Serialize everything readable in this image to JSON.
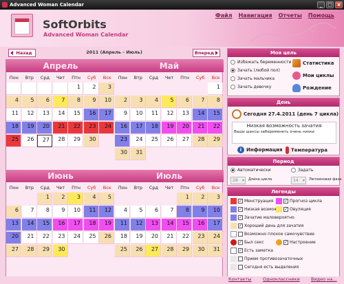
{
  "window": {
    "title": "Advanced Woman Calendar",
    "min": "_",
    "max": "□",
    "close": "x"
  },
  "header": {
    "brand": "SoftOrbits",
    "product": "Advanced Woman Calendar"
  },
  "menu": [
    "Файл",
    "Навигация",
    "Отчеты",
    "Помощь"
  ],
  "nav": {
    "prev": "Назад",
    "next": "Вперед",
    "period": "2011 (Апрель - Июль)"
  },
  "dow": [
    "Пон",
    "Втр",
    "Срд",
    "Чет",
    "Птн",
    "Суб",
    "Вск"
  ],
  "colors": {
    "menstruation": "#e8383c",
    "low": "#8080e8",
    "forecast": "#f04ef0",
    "ovulation": "#fde95a",
    "good": "#f7dfb2",
    "white": "#ffffff"
  },
  "months": [
    {
      "name": "Апрель",
      "cells": [
        {
          "d": "",
          "c": "white",
          "col": 0,
          "row": 0
        },
        {
          "d": "",
          "c": "white",
          "col": 1,
          "row": 0
        },
        {
          "d": "",
          "c": "white",
          "col": 2,
          "row": 0
        },
        {
          "d": "",
          "c": "white",
          "col": 3,
          "row": 0
        },
        {
          "d": "1",
          "c": "white",
          "col": 4,
          "row": 0
        },
        {
          "d": "2",
          "c": "white",
          "col": 5,
          "row": 0
        },
        {
          "d": "3",
          "c": "good",
          "col": 6,
          "row": 0
        },
        {
          "d": "4",
          "c": "good",
          "col": 0,
          "row": 1
        },
        {
          "d": "5",
          "c": "good",
          "col": 1,
          "row": 1
        },
        {
          "d": "6",
          "c": "good",
          "col": 2,
          "row": 1
        },
        {
          "d": "7",
          "c": "ovulation",
          "col": 3,
          "row": 1
        },
        {
          "d": "8",
          "c": "good",
          "col": 4,
          "row": 1
        },
        {
          "d": "9",
          "c": "good",
          "col": 5,
          "row": 1
        },
        {
          "d": "10",
          "c": "good",
          "col": 6,
          "row": 1
        },
        {
          "d": "11",
          "c": "white",
          "col": 0,
          "row": 2
        },
        {
          "d": "12",
          "c": "white",
          "col": 1,
          "row": 2
        },
        {
          "d": "13",
          "c": "white",
          "col": 2,
          "row": 2
        },
        {
          "d": "14",
          "c": "white",
          "col": 3,
          "row": 2
        },
        {
          "d": "15",
          "c": "white",
          "col": 4,
          "row": 2
        },
        {
          "d": "16",
          "c": "low",
          "col": 5,
          "row": 2
        },
        {
          "d": "17",
          "c": "low",
          "col": 6,
          "row": 2
        },
        {
          "d": "18",
          "c": "low",
          "col": 0,
          "row": 3
        },
        {
          "d": "19",
          "c": "low",
          "col": 1,
          "row": 3
        },
        {
          "d": "20",
          "c": "low",
          "col": 2,
          "row": 3
        },
        {
          "d": "21",
          "c": "menstruation",
          "col": 3,
          "row": 3
        },
        {
          "d": "22",
          "c": "menstruation",
          "col": 4,
          "row": 3
        },
        {
          "d": "23",
          "c": "menstruation",
          "col": 5,
          "row": 3
        },
        {
          "d": "24",
          "c": "menstruation",
          "col": 6,
          "row": 3
        },
        {
          "d": "25",
          "c": "menstruation",
          "col": 0,
          "row": 4
        },
        {
          "d": "26",
          "c": "white",
          "col": 1,
          "row": 4
        },
        {
          "d": "27",
          "c": "white",
          "col": 2,
          "row": 4
        },
        {
          "d": "28",
          "c": "white",
          "col": 3,
          "row": 4
        },
        {
          "d": "29",
          "c": "white",
          "col": 4,
          "row": 4
        },
        {
          "d": "30",
          "c": "good",
          "col": 5,
          "row": 4
        }
      ]
    },
    {
      "name": "Май",
      "cells": [
        {
          "d": "1",
          "c": "white",
          "col": 6,
          "row": 0
        },
        {
          "d": "2",
          "c": "good",
          "col": 0,
          "row": 1
        },
        {
          "d": "3",
          "c": "good",
          "col": 1,
          "row": 1
        },
        {
          "d": "4",
          "c": "good",
          "col": 2,
          "row": 1
        },
        {
          "d": "5",
          "c": "ovulation",
          "col": 3,
          "row": 1
        },
        {
          "d": "6",
          "c": "good",
          "col": 4,
          "row": 1
        },
        {
          "d": "7",
          "c": "good",
          "col": 5,
          "row": 1
        },
        {
          "d": "8",
          "c": "good",
          "col": 6,
          "row": 1
        },
        {
          "d": "9",
          "c": "white",
          "col": 0,
          "row": 2
        },
        {
          "d": "10",
          "c": "white",
          "col": 1,
          "row": 2
        },
        {
          "d": "11",
          "c": "white",
          "col": 2,
          "row": 2
        },
        {
          "d": "12",
          "c": "white",
          "col": 3,
          "row": 2
        },
        {
          "d": "13",
          "c": "white",
          "col": 4,
          "row": 2
        },
        {
          "d": "14",
          "c": "low",
          "col": 5,
          "row": 2
        },
        {
          "d": "15",
          "c": "low",
          "col": 6,
          "row": 2
        },
        {
          "d": "16",
          "c": "low",
          "col": 0,
          "row": 3
        },
        {
          "d": "17",
          "c": "low",
          "col": 1,
          "row": 3
        },
        {
          "d": "18",
          "c": "low",
          "col": 2,
          "row": 3
        },
        {
          "d": "19",
          "c": "forecast",
          "col": 3,
          "row": 3
        },
        {
          "d": "20",
          "c": "forecast",
          "col": 4,
          "row": 3
        },
        {
          "d": "21",
          "c": "forecast",
          "col": 5,
          "row": 3
        },
        {
          "d": "22",
          "c": "forecast",
          "col": 6,
          "row": 3
        },
        {
          "d": "23",
          "c": "low",
          "col": 0,
          "row": 4
        },
        {
          "d": "24",
          "c": "white",
          "col": 1,
          "row": 4
        },
        {
          "d": "25",
          "c": "white",
          "col": 2,
          "row": 4
        },
        {
          "d": "26",
          "c": "white",
          "col": 3,
          "row": 4
        },
        {
          "d": "27",
          "c": "white",
          "col": 4,
          "row": 4
        },
        {
          "d": "28",
          "c": "good",
          "col": 5,
          "row": 4
        },
        {
          "d": "29",
          "c": "good",
          "col": 6,
          "row": 4
        },
        {
          "d": "30",
          "c": "good",
          "col": 0,
          "row": 5
        },
        {
          "d": "31",
          "c": "good",
          "col": 1,
          "row": 5
        }
      ]
    },
    {
      "name": "Июнь",
      "cells": [
        {
          "d": "1",
          "c": "good",
          "col": 2,
          "row": 0
        },
        {
          "d": "2",
          "c": "good",
          "col": 3,
          "row": 0
        },
        {
          "d": "3",
          "c": "ovulation",
          "col": 4,
          "row": 0
        },
        {
          "d": "4",
          "c": "good",
          "col": 5,
          "row": 0
        },
        {
          "d": "5",
          "c": "good",
          "col": 6,
          "row": 0
        },
        {
          "d": "6",
          "c": "good",
          "col": 0,
          "row": 1
        },
        {
          "d": "7",
          "c": "white",
          "col": 1,
          "row": 1
        },
        {
          "d": "8",
          "c": "white",
          "col": 2,
          "row": 1
        },
        {
          "d": "9",
          "c": "white",
          "col": 3,
          "row": 1
        },
        {
          "d": "10",
          "c": "white",
          "col": 4,
          "row": 1
        },
        {
          "d": "11",
          "c": "low",
          "col": 5,
          "row": 1
        },
        {
          "d": "12",
          "c": "low",
          "col": 6,
          "row": 1
        },
        {
          "d": "13",
          "c": "low",
          "col": 0,
          "row": 2
        },
        {
          "d": "14",
          "c": "low",
          "col": 1,
          "row": 2
        },
        {
          "d": "15",
          "c": "low",
          "col": 2,
          "row": 2
        },
        {
          "d": "16",
          "c": "forecast",
          "col": 3,
          "row": 2
        },
        {
          "d": "17",
          "c": "forecast",
          "col": 4,
          "row": 2
        },
        {
          "d": "18",
          "c": "forecast",
          "col": 5,
          "row": 2
        },
        {
          "d": "19",
          "c": "forecast",
          "col": 6,
          "row": 2
        },
        {
          "d": "20",
          "c": "low",
          "col": 0,
          "row": 3
        },
        {
          "d": "21",
          "c": "white",
          "col": 1,
          "row": 3
        },
        {
          "d": "22",
          "c": "white",
          "col": 2,
          "row": 3
        },
        {
          "d": "23",
          "c": "white",
          "col": 3,
          "row": 3
        },
        {
          "d": "24",
          "c": "white",
          "col": 4,
          "row": 3
        },
        {
          "d": "25",
          "c": "white",
          "col": 5,
          "row": 3
        },
        {
          "d": "26",
          "c": "good",
          "col": 6,
          "row": 3
        },
        {
          "d": "27",
          "c": "good",
          "col": 0,
          "row": 4
        },
        {
          "d": "28",
          "c": "good",
          "col": 1,
          "row": 4
        },
        {
          "d": "29",
          "c": "good",
          "col": 2,
          "row": 4
        },
        {
          "d": "30",
          "c": "ovulation",
          "col": 3,
          "row": 4
        }
      ]
    },
    {
      "name": "Июль",
      "cells": [
        {
          "d": "1",
          "c": "good",
          "col": 4,
          "row": 0
        },
        {
          "d": "2",
          "c": "good",
          "col": 5,
          "row": 0
        },
        {
          "d": "3",
          "c": "good",
          "col": 6,
          "row": 0
        },
        {
          "d": "4",
          "c": "white",
          "col": 0,
          "row": 1
        },
        {
          "d": "5",
          "c": "white",
          "col": 1,
          "row": 1
        },
        {
          "d": "6",
          "c": "white",
          "col": 2,
          "row": 1
        },
        {
          "d": "7",
          "c": "white",
          "col": 3,
          "row": 1
        },
        {
          "d": "8",
          "c": "low",
          "col": 4,
          "row": 1
        },
        {
          "d": "9",
          "c": "low",
          "col": 5,
          "row": 1
        },
        {
          "d": "10",
          "c": "low",
          "col": 6,
          "row": 1
        },
        {
          "d": "11",
          "c": "low",
          "col": 0,
          "row": 2
        },
        {
          "d": "12",
          "c": "low",
          "col": 1,
          "row": 2
        },
        {
          "d": "13",
          "c": "forecast",
          "col": 2,
          "row": 2
        },
        {
          "d": "14",
          "c": "forecast",
          "col": 3,
          "row": 2
        },
        {
          "d": "15",
          "c": "forecast",
          "col": 4,
          "row": 2
        },
        {
          "d": "16",
          "c": "forecast",
          "col": 5,
          "row": 2
        },
        {
          "d": "17",
          "c": "low",
          "col": 6,
          "row": 2
        },
        {
          "d": "18",
          "c": "white",
          "col": 0,
          "row": 3
        },
        {
          "d": "19",
          "c": "white",
          "col": 1,
          "row": 3
        },
        {
          "d": "20",
          "c": "white",
          "col": 2,
          "row": 3
        },
        {
          "d": "21",
          "c": "white",
          "col": 3,
          "row": 3
        },
        {
          "d": "22",
          "c": "white",
          "col": 4,
          "row": 3
        },
        {
          "d": "23",
          "c": "good",
          "col": 5,
          "row": 3
        },
        {
          "d": "24",
          "c": "good",
          "col": 6,
          "row": 3
        },
        {
          "d": "25",
          "c": "good",
          "col": 0,
          "row": 4
        },
        {
          "d": "26",
          "c": "good",
          "col": 1,
          "row": 4
        },
        {
          "d": "27",
          "c": "ovulation",
          "col": 2,
          "row": 4
        },
        {
          "d": "28",
          "c": "good",
          "col": 3,
          "row": 4
        },
        {
          "d": "29",
          "c": "good",
          "col": 4,
          "row": 4
        },
        {
          "d": "30",
          "c": "good",
          "col": 5,
          "row": 4
        },
        {
          "d": "31",
          "c": "good",
          "col": 6,
          "row": 4
        }
      ]
    }
  ],
  "goal": {
    "title": "Моя цель",
    "options": [
      "Избежать беременности",
      "Зачать (любой пол)",
      "Зачать мальчика",
      "Зачать девочку"
    ],
    "selected": 1,
    "links": [
      "Статистика",
      "Мои циклы",
      "Рождение"
    ]
  },
  "day": {
    "title": "День",
    "today": "Сегодня 27.4.2011 (день 7 цикла)",
    "chance": "Низкая возможность зачатия",
    "detail": "Ваши шансы забеременеть очень низки",
    "info": "Информация",
    "temp": "Температура"
  },
  "period": {
    "title": "Период",
    "auto": "Автоматически",
    "set": "Задать",
    "cycle_val": "28",
    "cycle_label": "Длина цикла",
    "men_val": "14",
    "men_label": "Лютеиновая фаза"
  },
  "legend": {
    "title": "Легенды",
    "items": [
      "Менструация",
      "Прогноз цикла",
      "Низкая возмож.",
      "Овуляция",
      "Зачатие маловероятно",
      "Хороший день для зачатия",
      "Возможно плохое самочувствие",
      "Был секс",
      "Настроение",
      "Есть заметка",
      "Прием противозачаточных",
      "Сегодня есть выделения"
    ]
  },
  "statusbar": {
    "contacts": "Контакты",
    "classmates": "Одноклассники",
    "video": "Видео на..."
  }
}
